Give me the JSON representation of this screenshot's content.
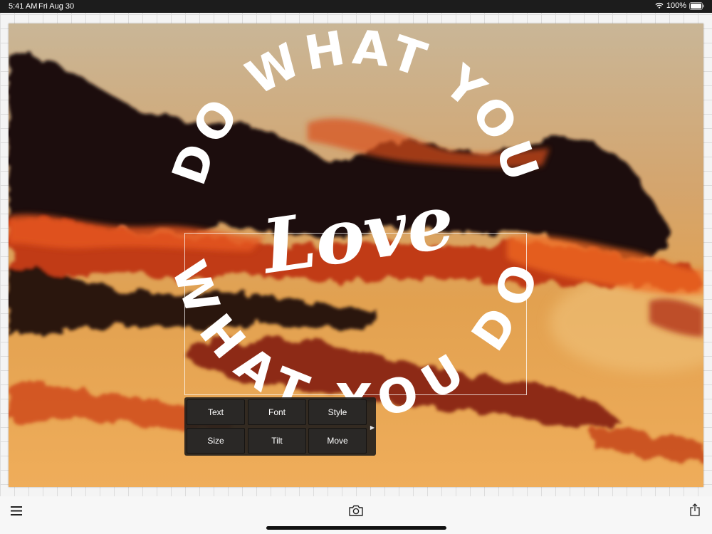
{
  "status_bar": {
    "time": "5:41 AM",
    "date": "Fri Aug 30",
    "battery_text": "100%"
  },
  "artwork": {
    "arc_top_text": "DO WHAT YOU",
    "center_text": "Love",
    "arc_bottom_text": "WHAT YOU DO",
    "text_color": "#ffffff"
  },
  "toolbar": {
    "buttons": [
      "Text",
      "Font",
      "Style",
      "Size",
      "Tilt",
      "Move"
    ],
    "more_icon": "triangle-right-icon"
  },
  "bottom_bar": {
    "menu_icon": "hamburger-menu-icon",
    "camera_icon": "camera-icon",
    "share_icon": "share-icon"
  },
  "colors": {
    "status_bar_bg": "#1c1c1c",
    "toolbar_bg": "#23201c",
    "grid_line": "#dcdcdc"
  }
}
